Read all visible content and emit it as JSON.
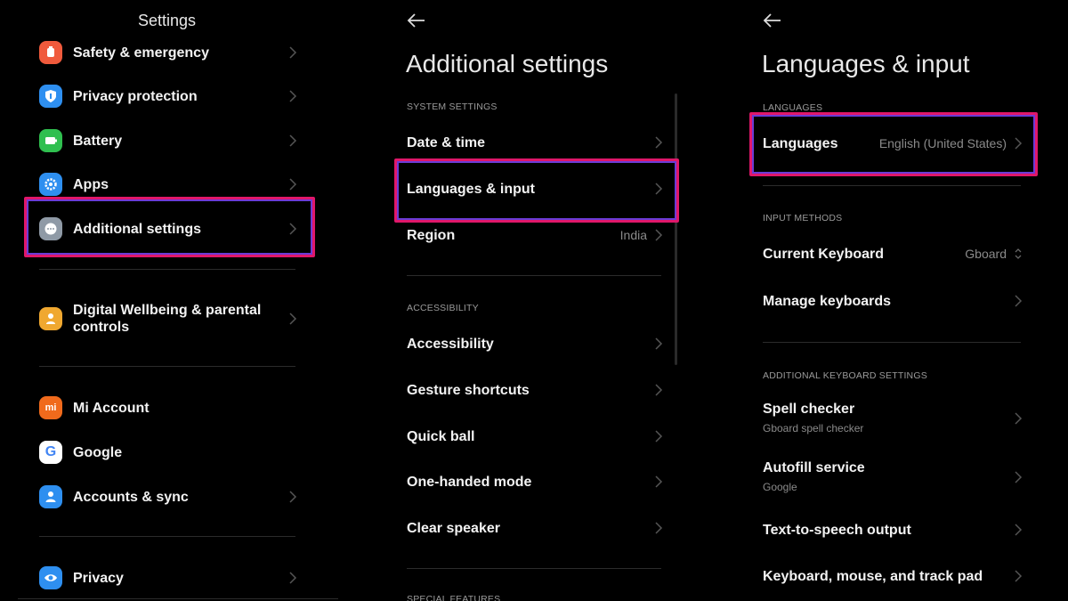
{
  "panel1": {
    "title": "Settings",
    "items": [
      {
        "label": "Safety & emergency",
        "icon": "safety-icon",
        "color": "#f05a3c"
      },
      {
        "label": "Privacy protection",
        "icon": "privacy-protection-icon",
        "color": "#2e8ff0"
      },
      {
        "label": "Battery",
        "icon": "battery-icon",
        "color": "#2fbf4f"
      },
      {
        "label": "Apps",
        "icon": "gear-icon",
        "color": "#2e8ff0"
      },
      {
        "label": "Additional settings",
        "icon": "more-dots-icon",
        "color": "#8f9aa6"
      },
      {
        "label_line1": "Digital Wellbeing & parental",
        "label_line2": "controls",
        "icon": "wellbeing-icon",
        "color": "#f0a830"
      },
      {
        "label": "Mi Account",
        "icon": "mi-icon",
        "color": "#f06a1c"
      },
      {
        "label": "Google",
        "icon": "google-icon",
        "color": "#ffffff"
      },
      {
        "label": "Accounts & sync",
        "icon": "account-icon",
        "color": "#2e8ff0"
      },
      {
        "label": "Privacy",
        "icon": "eye-icon",
        "color": "#2e8ff0"
      }
    ]
  },
  "panel2": {
    "title": "Additional settings",
    "section_system": "SYSTEM SETTINGS",
    "section_accessibility": "ACCESSIBILITY",
    "section_special": "SPECIAL FEATURES",
    "items": {
      "date_time": "Date & time",
      "languages_input": "Languages & input",
      "region": "Region",
      "region_value": "India",
      "accessibility": "Accessibility",
      "gesture_shortcuts": "Gesture shortcuts",
      "quick_ball": "Quick ball",
      "one_handed": "One-handed mode",
      "clear_speaker": "Clear speaker"
    }
  },
  "panel3": {
    "title": "Languages & input",
    "section_languages": "LANGUAGES",
    "section_input": "INPUT METHODS",
    "section_additional": "ADDITIONAL KEYBOARD SETTINGS",
    "items": {
      "languages": "Languages",
      "languages_value": "English (United States)",
      "current_keyboard": "Current Keyboard",
      "current_keyboard_value": "Gboard",
      "manage_keyboards": "Manage keyboards",
      "spell_checker": "Spell checker",
      "spell_checker_sub": "Gboard spell checker",
      "autofill": "Autofill service",
      "autofill_sub": "Google",
      "tts": "Text-to-speech output",
      "keyboard_mouse": "Keyboard, mouse, and track pad"
    }
  },
  "colors": {
    "highlight_outer": "#e0176a",
    "highlight_inner": "#6b3bd6",
    "background": "#000000"
  }
}
